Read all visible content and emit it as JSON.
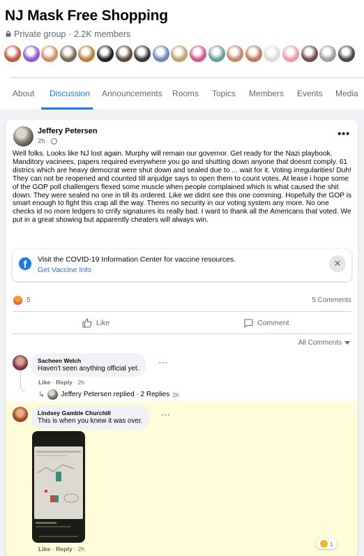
{
  "group": {
    "title": "NJ Mask Free Shopping",
    "privacy": "Private group",
    "members": "· 2.2K members"
  },
  "member_avatars": [
    "#c45a3a",
    "#8e5ad6",
    "#d48c6a",
    "#7a6a5a",
    "#b8823a",
    "#202020",
    "#5a4a3a",
    "#3a3a3a",
    "#6a8ab8",
    "#c4a06a",
    "#d45a8a",
    "#6aa0a0",
    "#c48a6a",
    "#c47a5a",
    "#dcdcdc",
    "#e89aa8",
    "#7a4a4a",
    "#a0a0a0",
    "#4a4a4a"
  ],
  "tabs": [
    "About",
    "Discussion",
    "Announcements",
    "Rooms",
    "Topics",
    "Members",
    "Events",
    "Media"
  ],
  "active_tab": "Discussion",
  "colors": {
    "accent": "#1877f2",
    "highlight": "#fefcd9",
    "secondary_text": "#65676b"
  },
  "post": {
    "author": "Jeffery Petersen",
    "time": "2h ·",
    "more": "•••",
    "body": "Well folks.  Looks like NJ lost again.  Murphy will remain our governor.   Get ready for the Nazi playbook. Manditory vacinees, papers required everywhere you go and shutting down anyone that doesnt comply.   61 districs which are heavy democrat were shut down and sealed due to ... wait for it. Voting irregularities!  Duh!   They can not be reopened and counted till anjudge says to open them to count votes.   At lease i hope some of the GOP poll challengers flexed some muscle when people complained which is what caused the shit down.  They were sealed no one in till its ordered.  Like we didnt see this one comming.  Hopefully the GOP is smart enough to fight this crap all the way.   Theres no security in our voting system any more.   No one checks id no more ledgers to crrify signatures its really bad.   I want to thank all the Americans that voted.  We put in a great showing but apparently cheaters will always win.",
    "covid_text": "Visit the COVID-19 Information Center for vaccine resources.",
    "covid_link": "Get Vaccine Info",
    "reaction_count": "5",
    "comments_count": "5 Comments",
    "like_label": "Like",
    "comment_label": "Comment",
    "sort_label": "All Comments"
  },
  "comments": [
    {
      "name": "Sacheen Welch",
      "text": "Haven't seen anything official yet.",
      "like": "Like",
      "reply": "Reply",
      "time": "2h",
      "replied_text": "Jeffery Petersen replied · 2 Replies",
      "replied_time": "2h"
    },
    {
      "name": "Lindsey Gamble Churchill",
      "text": "This is when you knew it was over.",
      "like": "Like",
      "reply": "Reply",
      "time": "2h",
      "reaction_count": "1"
    }
  ]
}
